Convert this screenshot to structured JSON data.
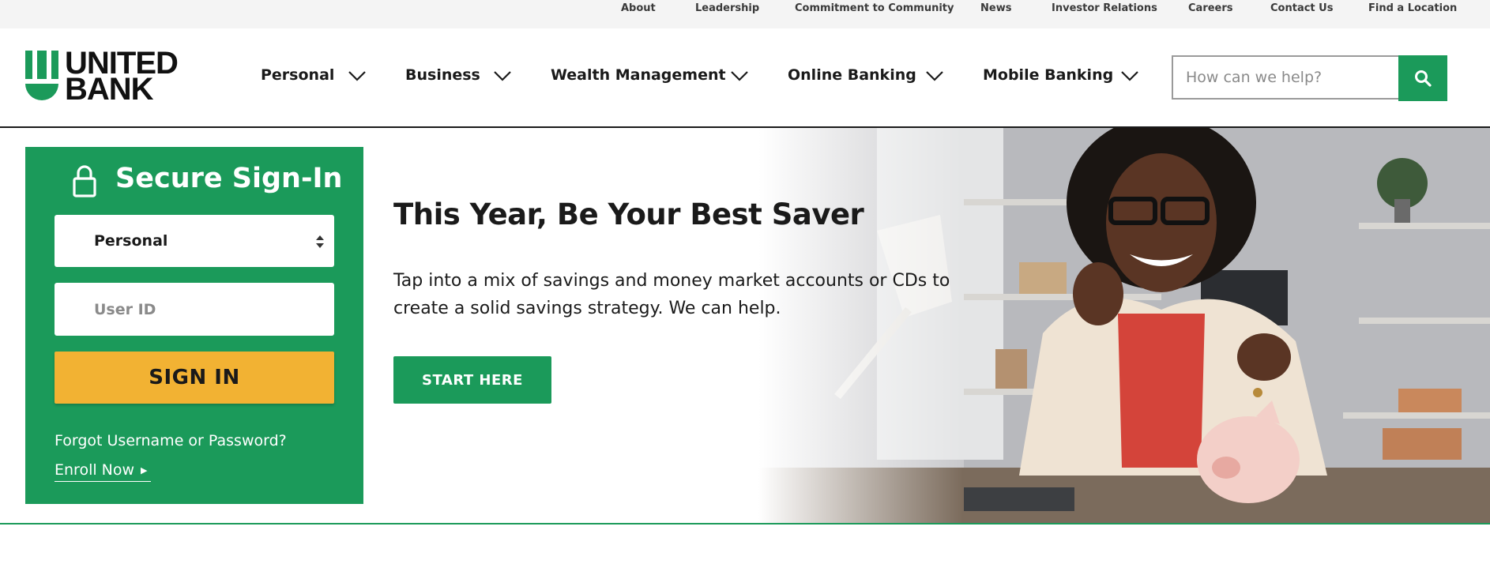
{
  "utility_nav": [
    "About",
    "Leadership",
    "Commitment to Community",
    "News",
    "Investor Relations",
    "Careers",
    "Contact Us",
    "Find a Location"
  ],
  "logo": {
    "line1": "UNITED",
    "line2": "BANK"
  },
  "main_nav": [
    {
      "label": "Personal",
      "icon": "chevron-down-icon"
    },
    {
      "label": "Business",
      "icon": "chevron-down-icon"
    },
    {
      "label": "Wealth Management",
      "icon": "chevron-down-icon"
    },
    {
      "label": "Online Banking",
      "icon": "chevron-down-icon"
    },
    {
      "label": "Mobile Banking",
      "icon": "chevron-down-icon"
    }
  ],
  "search": {
    "placeholder": "How can we help?",
    "icon": "search-icon"
  },
  "signin": {
    "title": "Secure Sign-In",
    "icon": "lock-icon",
    "account_type": "Personal",
    "userid_placeholder": "User ID",
    "button": "SIGN IN",
    "forgot": "Forgot Username or Password?",
    "enroll": "Enroll Now"
  },
  "hero": {
    "title": "This Year, Be Your Best Saver",
    "body": "Tap into a mix of savings and money market accounts or CDs to create a solid savings strategy. We can help.",
    "cta": "START HERE"
  },
  "colors": {
    "brand_green": "#1b9a5a",
    "signin_yellow": "#f2b233",
    "text_dark": "#1a1a1a"
  }
}
